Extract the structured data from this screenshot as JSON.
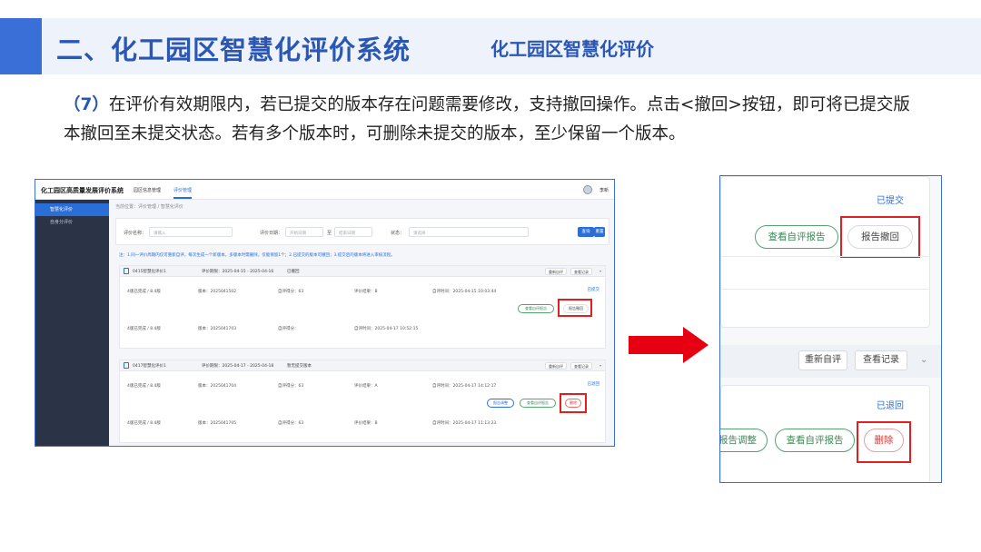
{
  "slide": {
    "title": "二、化工园区智慧化评价系统",
    "subtitle": "化工园区智慧化评价",
    "body_num": "（7）",
    "body_text": "在评价有效期限内，若已提交的版本存在问题需要修改，支持撤回操作。点击<撤回>按钮，即可将已提交版本撤回至未提交状态。若有多个版本时，可删除未提交的版本，至少保留一个版本。"
  },
  "screenshot": {
    "brand": "化工园区高质量发展评价系统",
    "nav": [
      "园区信息管理",
      "评价管理"
    ],
    "user": "李新",
    "sidebar": [
      "智慧化评价",
      "自身分评价"
    ],
    "breadcrumb": "当前位置：评价管理 / 智慧化评价",
    "search": {
      "name_label": "评价名称：",
      "name_placeholder": "请输入",
      "period_label": "评价日期：",
      "start_placeholder": "开始日期",
      "to": "至",
      "end_placeholder": "结束日期",
      "status_label": "状态：",
      "status_placeholder": "请选择",
      "query": "查询",
      "reset": "重置"
    },
    "note": "注：1.同一评价周期内仅可重新自评，每次生成一个新版本，多版本时需删除，仅能保留1个；2.已提交的版本可撤回；3.提交后的版本将进入审核流程。",
    "cards": [
      {
        "name": "0415智慧化评价1",
        "period": "评价期限：2025-04-15 - 2025-04-16",
        "status": "已撤回",
        "btn_reeval": "重新自评",
        "btn_records": "查看记录",
        "rows": [
          {
            "version": "4版已完成 / 8.4版",
            "no": "版本：2025041502",
            "score": "自评得分：63",
            "result": "评价结果：B",
            "time": "自评时间：2025-04-15 10:03:44",
            "state": "已提交"
          },
          {
            "version": "4版已完成 / 8.4版",
            "no": "版本：2025041703",
            "score": "自评得分：",
            "result": "",
            "time": "自评时间：2025-04-17 10:52:15",
            "state": ""
          }
        ],
        "btn_view": "查看自评报告",
        "btn_withdraw": "报告撤回"
      },
      {
        "name": "0417智慧化评价1",
        "period": "评价期限：2025-04-17 - 2025-04-18",
        "status": "暂无提交版本",
        "btn_reeval": "重新自评",
        "btn_records": "查看记录",
        "rows": [
          {
            "version": "4版已完成 / 8.4版",
            "no": "版本：2025041704",
            "score": "自评得分：63",
            "result": "评价结果：A",
            "time": "自评时间：2025-04-17 14:12:17",
            "state": "已退回"
          },
          {
            "version": "4版已完成 / 8.4版",
            "no": "版本：2025041705",
            "score": "自评得分：63",
            "result": "评价结果：B",
            "time": "自评时间：2025-04-17 11:13:23",
            "state": ""
          }
        ],
        "btn_adjust": "报告调整",
        "btn_view": "查看自评报告",
        "btn_delete": "删除"
      }
    ]
  },
  "zoom": {
    "state_submitted": "已提交",
    "btn_view": "查看自评报告",
    "btn_withdraw": "报告撤回",
    "btn_reeval": "重新自评",
    "btn_records": "查看记录",
    "state_returned": "已退回",
    "btn_adjust": "报告调整",
    "btn_view2": "查看自评报告",
    "btn_delete": "删除"
  },
  "colors": {
    "accent": "#2a56b4",
    "highlight": "#e02020",
    "arrow": "#e60012"
  }
}
